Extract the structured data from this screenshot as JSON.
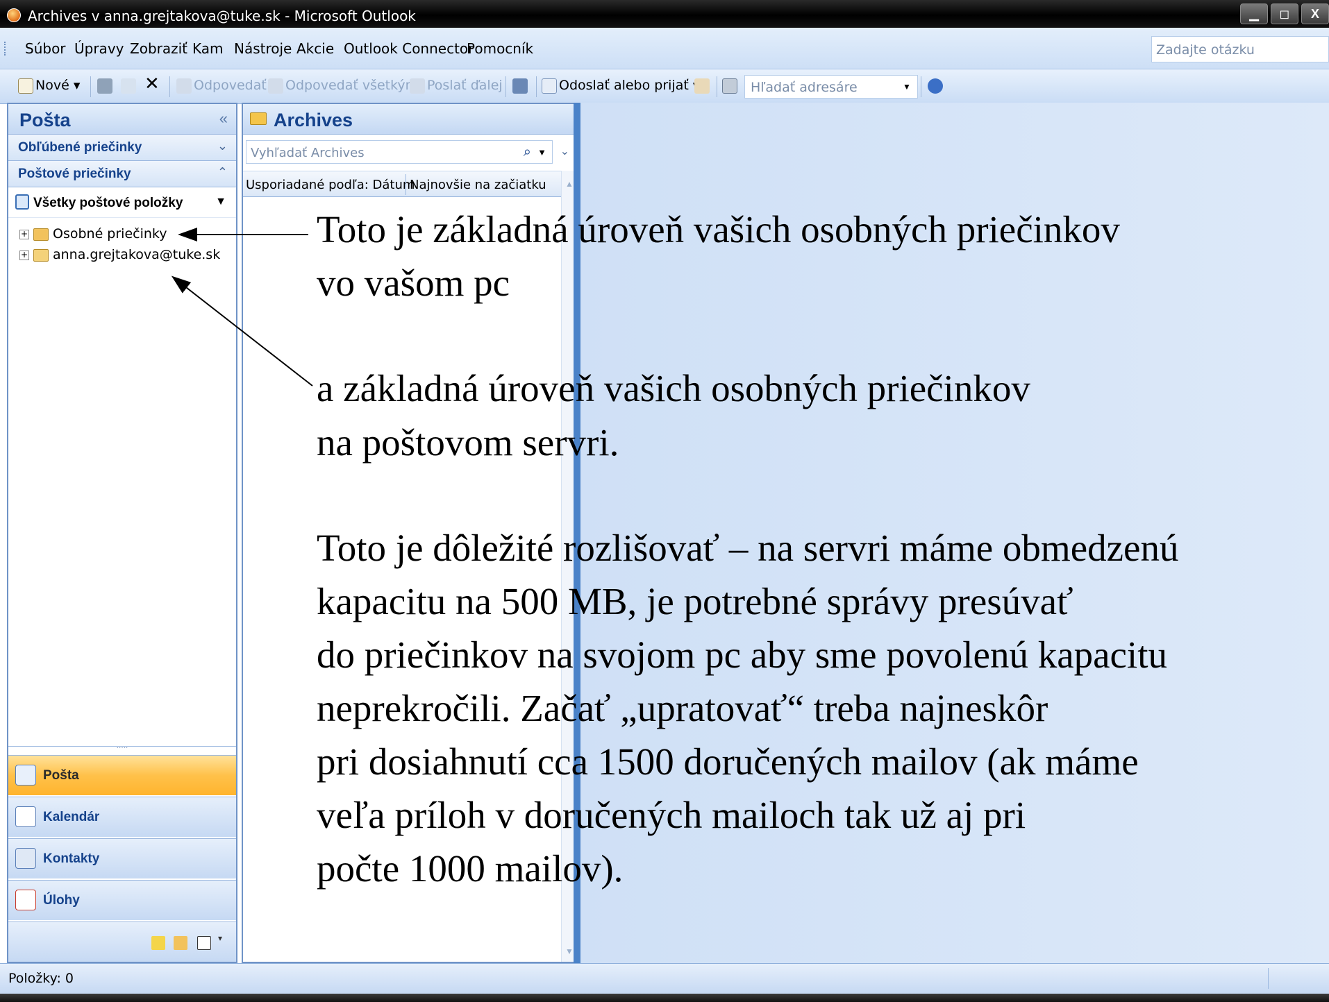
{
  "window": {
    "title": "Archives v anna.grejtakova@tuke.sk - Microsoft Outlook",
    "buttons": [
      "▁",
      "◻",
      "X"
    ]
  },
  "menubar": {
    "items": [
      "Súbor",
      "Úpravy",
      "Zobraziť",
      "Kam",
      "Nástroje",
      "Akcie",
      "Outlook Connector",
      "Pomocník"
    ],
    "ask_placeholder": "Zadajte otázku"
  },
  "toolbar": {
    "new": "Nové",
    "reply": "Odpovedať",
    "reply_all": "Odpovedať všetkým",
    "forward": "Poslať ďalej",
    "send_receive": "Odoslať alebo prijať",
    "address_search": "Hľadať adresáre"
  },
  "nav": {
    "title": "Pošta",
    "collapse_glyph": "«",
    "favorites": "Obľúbené priečinky",
    "mail_folders": "Poštové priečinky",
    "all_items": "Všetky poštové položky",
    "tree": [
      "Osobné priečinky",
      "anna.grejtakova@tuke.sk"
    ],
    "buttons": [
      "Pošta",
      "Kalendár",
      "Kontakty",
      "Úlohy"
    ],
    "splitter": "·····"
  },
  "list": {
    "title": "Archives",
    "search_placeholder": "Vyhľadať Archives",
    "sort_by": "Usporiadané podľa: Dátum",
    "order": "Najnovšie na začiatku"
  },
  "status": {
    "items": "Položky: 0"
  },
  "annotations": {
    "block1": [
      "Toto je základná úroveň vašich osobných priečinkov",
      "vo vašom pc"
    ],
    "block2": [
      "a základná úroveň vašich osobných priečinkov",
      "na poštovom servri."
    ],
    "block3": [
      "Toto je dôležité rozlišovať – na servri máme obmedzenú",
      "kapacitu na 500 MB, je potrebné správy presúvať",
      "do priečinkov na svojom pc aby sme povolenú kapacitu",
      "neprekročili. Začať „upratovať“ treba najneskôr",
      "pri dosiahnutí cca 1500 doručených mailov (ak máme",
      "veľa príloh v doručených mailoch tak už aj pri",
      "počte 1000 mailov)."
    ]
  },
  "colors": {
    "office_blue": "#15428b",
    "active_nav": "#ffc14a",
    "reading_pane": "#d5e4f7"
  }
}
